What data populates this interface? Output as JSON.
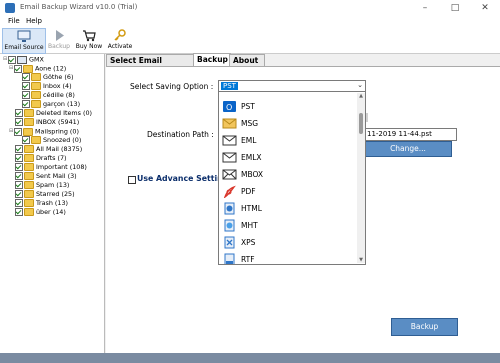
{
  "window": {
    "title": "Email Backup Wizard v10.0 (Trial)"
  },
  "menu": [
    "File",
    "Help"
  ],
  "toolbar": {
    "email_source": "Email Source",
    "backup": "Backup",
    "buy_now": "Buy Now",
    "activate": "Activate"
  },
  "tree": {
    "root": "GMX",
    "items": [
      "Aone (12)",
      "Göthe (6)",
      "Inbox (4)",
      "cédille (8)",
      "garçon (13)",
      "Deleted Items (0)",
      "INBOX (5941)",
      "Mailspring (0)",
      "Snoozed (0)",
      "All Mail (8375)",
      "Drafts (7)",
      "Important (108)",
      "Sent Mail (3)",
      "Spam (13)",
      "Starred (25)",
      "Trash (13)",
      "über (14)"
    ]
  },
  "tabs": [
    "Select Email Source",
    "Backup",
    "About"
  ],
  "form": {
    "saving_label": "Select Saving Option :",
    "saving_value": "PST",
    "destination_label": "Destination Path :",
    "destination_value": "11-2019 11-44.pst",
    "change_label": "Change...",
    "advance_label": "Use Advance Settings",
    "backup_label": "Backup"
  },
  "options": [
    {
      "label": "PST",
      "icon": "outlook-icon",
      "color": "#0a64c8"
    },
    {
      "label": "MSG",
      "icon": "envelope-icon",
      "color": "#e8b23a"
    },
    {
      "label": "EML",
      "icon": "mail-icon",
      "color": "#444444"
    },
    {
      "label": "EMLX",
      "icon": "mail-icon",
      "color": "#444444"
    },
    {
      "label": "MBOX",
      "icon": "mailbox-icon",
      "color": "#444444"
    },
    {
      "label": "PDF",
      "icon": "pdf-icon",
      "color": "#d9352a"
    },
    {
      "label": "HTML",
      "icon": "html-icon",
      "color": "#2f76c8"
    },
    {
      "label": "MHT",
      "icon": "mht-icon",
      "color": "#2f76c8"
    },
    {
      "label": "XPS",
      "icon": "xps-icon",
      "color": "#2f76c8"
    },
    {
      "label": "RTF",
      "icon": "rtf-icon",
      "color": "#2f76c8"
    }
  ]
}
